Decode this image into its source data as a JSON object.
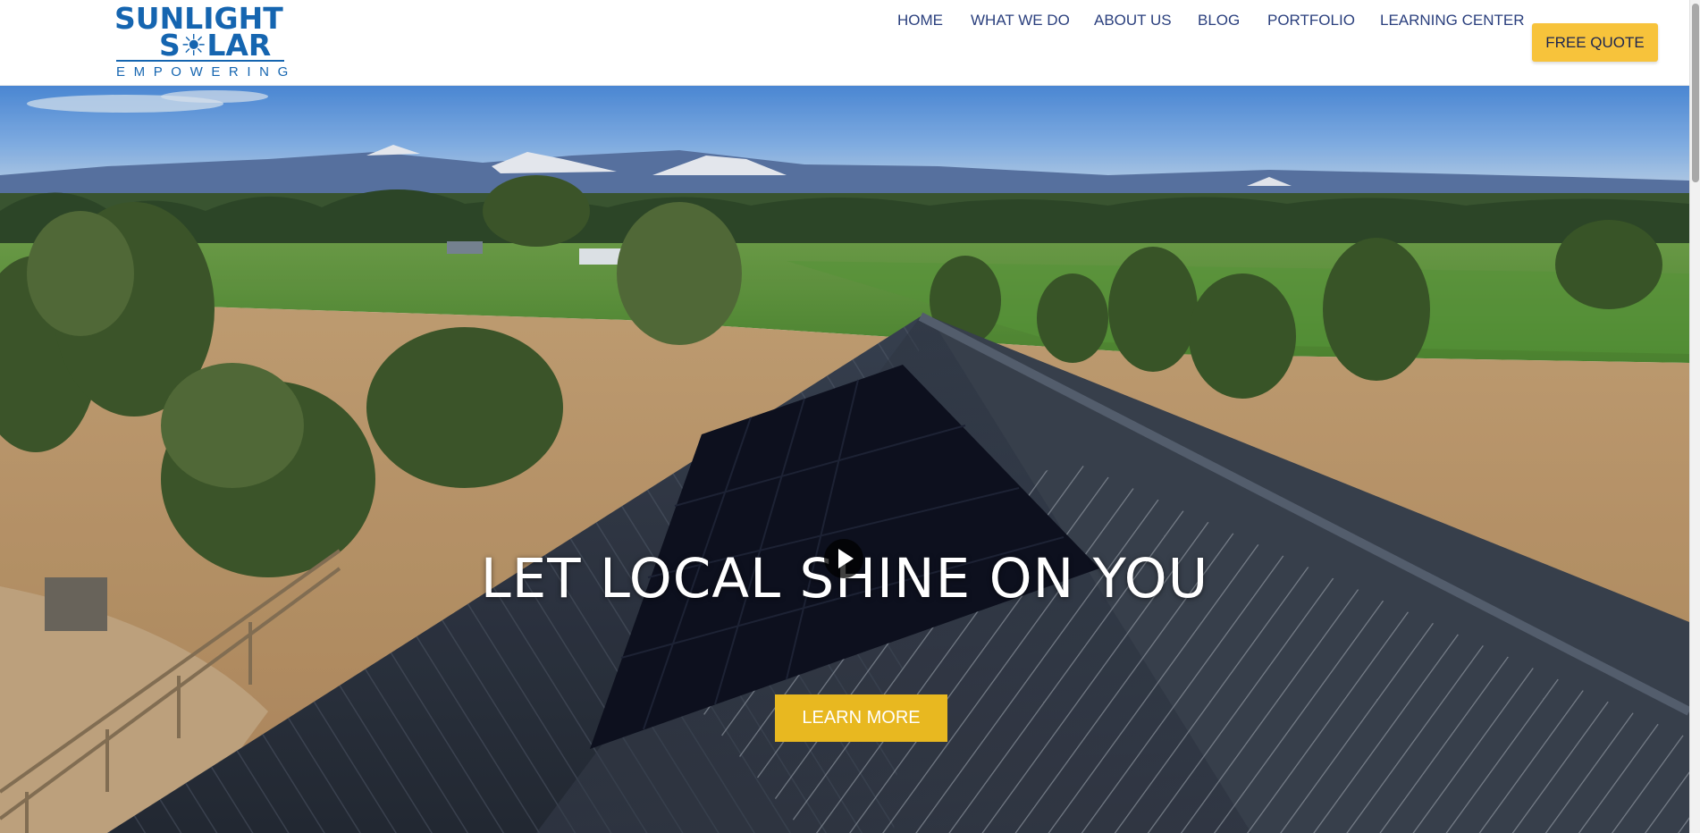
{
  "logo": {
    "line1": "SUNLIGHT",
    "line2": "S☀LAR",
    "tagline": "EMPOWERING"
  },
  "nav": {
    "items": [
      {
        "label": "HOME"
      },
      {
        "label": "WHAT WE DO"
      },
      {
        "label": "ABOUT US"
      },
      {
        "label": "BLOG"
      },
      {
        "label": "PORTFOLIO"
      },
      {
        "label": "LEARNING CENTER"
      }
    ],
    "cta_label": "FREE QUOTE"
  },
  "hero": {
    "headline": "LET LOCAL SHINE ON YOU",
    "button_label": "LEARN MORE"
  },
  "colors": {
    "brand_blue": "#1565b0",
    "nav_text": "#2a3f7d",
    "quote_yellow": "#f7c33b",
    "learn_gold": "#e8b820"
  }
}
